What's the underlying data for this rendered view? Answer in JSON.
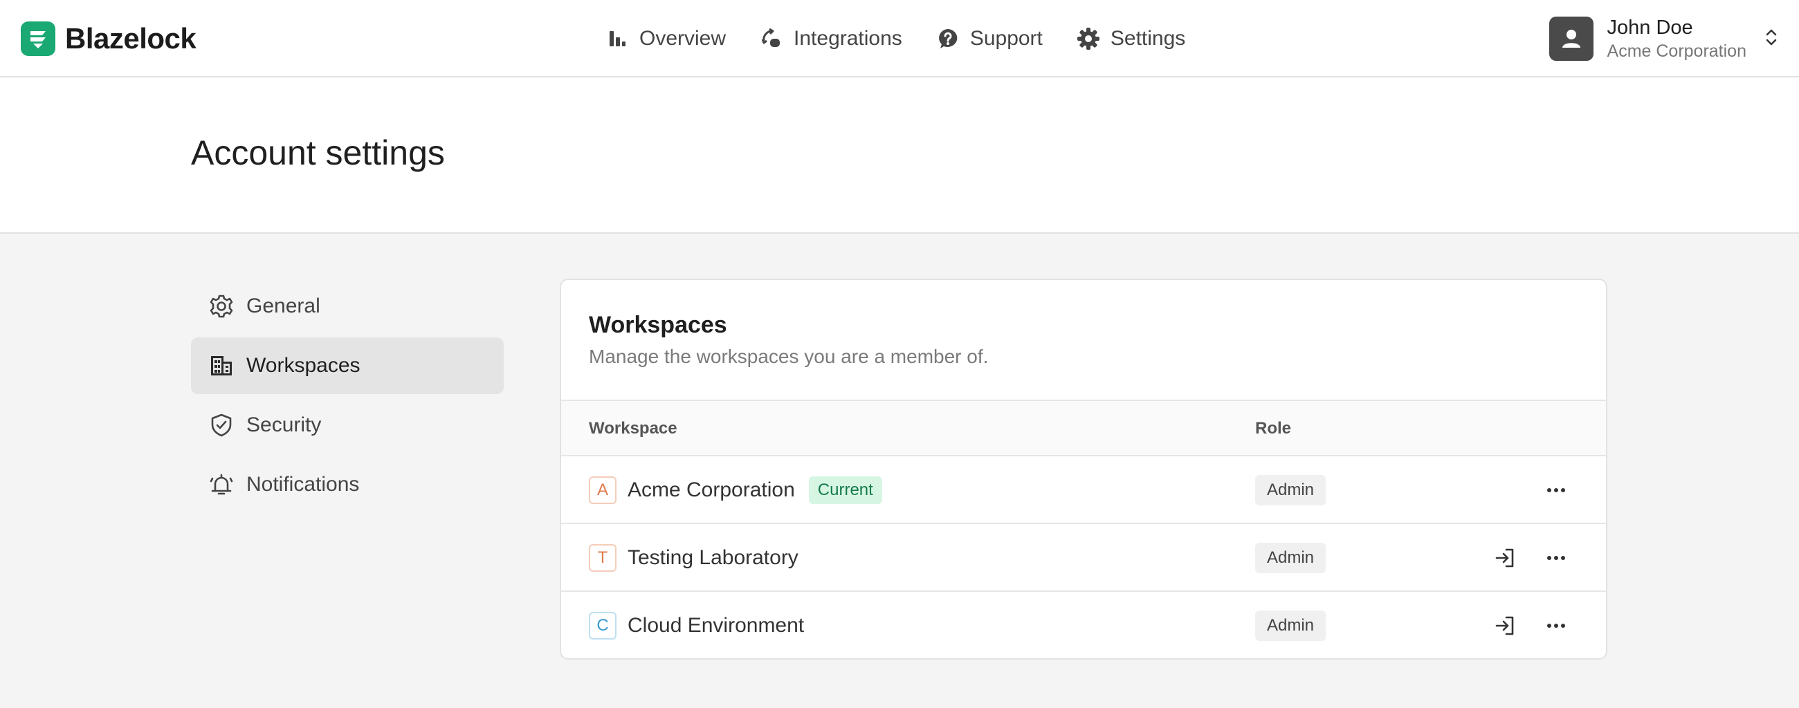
{
  "brand": {
    "name": "Blazelock",
    "logo_color": "#1aa873"
  },
  "nav": [
    {
      "label": "Overview",
      "icon": "bar-chart-icon"
    },
    {
      "label": "Integrations",
      "icon": "integrations-icon"
    },
    {
      "label": "Support",
      "icon": "help-circle-icon"
    },
    {
      "label": "Settings",
      "icon": "gear-icon"
    }
  ],
  "user": {
    "name": "John Doe",
    "org": "Acme Corporation",
    "icon": "person-icon",
    "menu_icon": "chevron-up-down-icon"
  },
  "page": {
    "title": "Account settings"
  },
  "sidebar": {
    "items": [
      {
        "label": "General",
        "icon": "gear-outline-icon",
        "active": false
      },
      {
        "label": "Workspaces",
        "icon": "building-icon",
        "active": true
      },
      {
        "label": "Security",
        "icon": "shield-check-icon",
        "active": false
      },
      {
        "label": "Notifications",
        "icon": "bell-icon",
        "active": false
      }
    ]
  },
  "workspaces": {
    "title": "Workspaces",
    "subtitle": "Manage the workspaces you are a member of.",
    "columns": {
      "workspace": "Workspace",
      "role": "Role"
    },
    "rows": [
      {
        "letter": "A",
        "letter_color": "#e07b4f",
        "name": "Acme Corporation",
        "badge": "Current",
        "role": "Admin",
        "can_switch": false
      },
      {
        "letter": "T",
        "letter_color": "#e07b4f",
        "name": "Testing Laboratory",
        "badge": "",
        "role": "Admin",
        "can_switch": true
      },
      {
        "letter": "C",
        "letter_color": "#3a9bd0",
        "name": "Cloud Environment",
        "badge": "",
        "role": "Admin",
        "can_switch": true
      }
    ],
    "row_icons": {
      "switch": "sign-in-icon",
      "more": "more-horizontal-icon"
    }
  },
  "colors": {
    "accent": "#1aa873",
    "current_badge_bg": "#d6f6e3",
    "current_badge_text": "#147a4a"
  }
}
